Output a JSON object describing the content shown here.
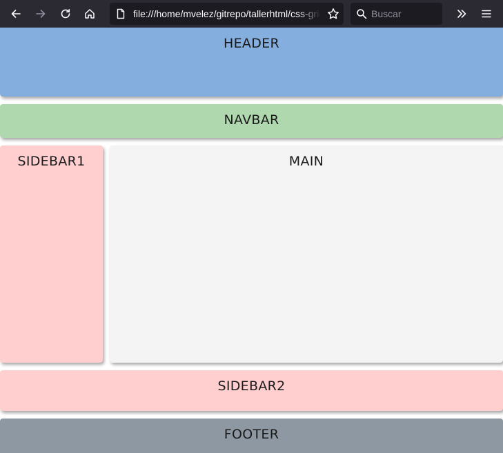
{
  "browser": {
    "back_icon": "arrow-left-icon",
    "forward_icon": "arrow-right-icon",
    "reload_icon": "reload-icon",
    "home_icon": "home-icon",
    "page_icon": "page-icon",
    "url": "file:///home/mvelez/gitrepo/tallerhtml/css-grid",
    "bookmark_icon": "star-icon",
    "search_placeholder": "Buscar",
    "overflow_icon": "chevron-double-right-icon",
    "menu_icon": "hamburger-menu-icon",
    "colors": {
      "toolbar": "#2b2a33",
      "field": "#1c1b22",
      "text": "#fbfbfe"
    }
  },
  "page": {
    "header": {
      "label": "HEADER",
      "color": "#84aedd"
    },
    "navbar": {
      "label": "NAVBAR",
      "color": "#b0d8af"
    },
    "sidebar1": {
      "label": "SIDEBAR1",
      "color": "#ffcfcf"
    },
    "main": {
      "label": "MAIN",
      "color": "#f4f4f4"
    },
    "sidebar2": {
      "label": "SIDEBAR2",
      "color": "#ffcfcf"
    },
    "footer": {
      "label": "FOOTER",
      "color": "#8d98a2"
    }
  }
}
